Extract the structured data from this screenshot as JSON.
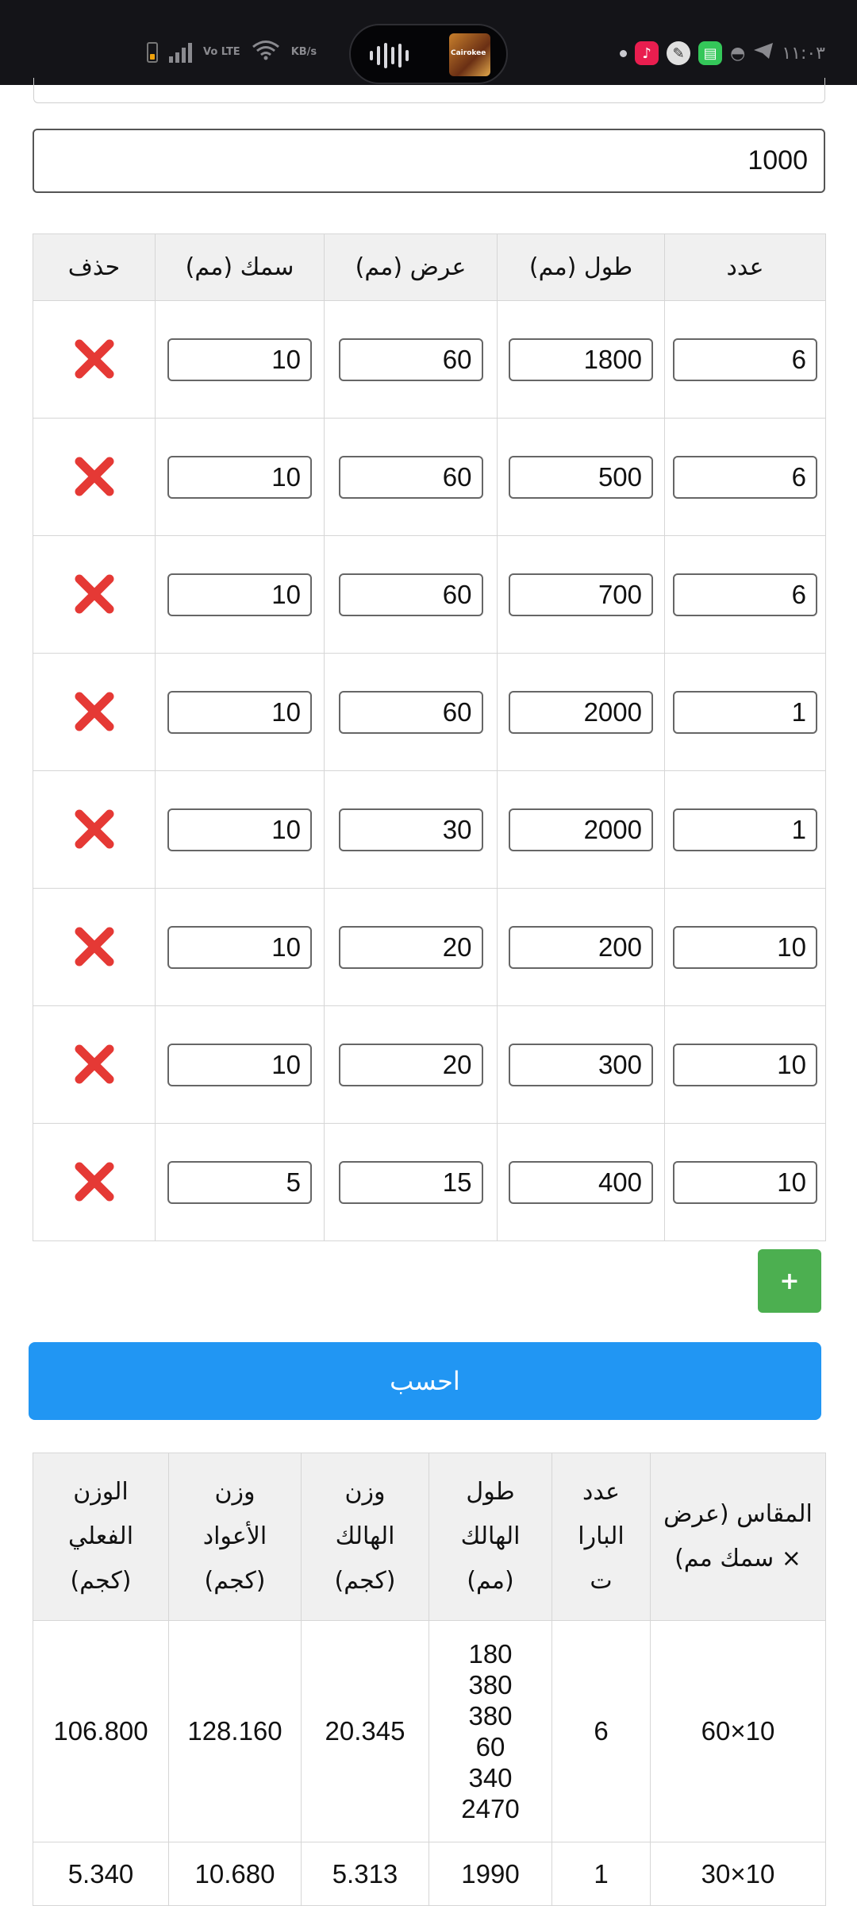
{
  "status_bar": {
    "time": "١١:٠٣",
    "network_small": "Vo LTE",
    "speed_unit": "KB/s",
    "album_label": "Cairokee",
    "icons": [
      "battery-icon",
      "signal-icon",
      "volte-icon",
      "wifi-icon",
      "audio-wave-icon",
      "music-app-icon",
      "calligraphy-app-icon",
      "messages-app-icon",
      "gamepad-icon",
      "telegram-icon"
    ]
  },
  "top_field": {
    "value": "1000"
  },
  "pieces_table": {
    "headers": {
      "count": "عدد",
      "length": "طول (مم)",
      "width": "عرض (مم)",
      "thickness": "سمك (مم)",
      "delete": "حذف"
    },
    "rows": [
      {
        "count": "6",
        "length": "1800",
        "width": "60",
        "thickness": "10"
      },
      {
        "count": "6",
        "length": "500",
        "width": "60",
        "thickness": "10"
      },
      {
        "count": "6",
        "length": "700",
        "width": "60",
        "thickness": "10"
      },
      {
        "count": "1",
        "length": "2000",
        "width": "60",
        "thickness": "10"
      },
      {
        "count": "1",
        "length": "2000",
        "width": "30",
        "thickness": "10"
      },
      {
        "count": "10",
        "length": "200",
        "width": "20",
        "thickness": "10"
      },
      {
        "count": "10",
        "length": "300",
        "width": "20",
        "thickness": "10"
      },
      {
        "count": "10",
        "length": "400",
        "width": "15",
        "thickness": "5"
      }
    ],
    "delete_icon": "red-x-icon",
    "delete_color": "#e53935"
  },
  "buttons": {
    "add_label": "+",
    "calculate_label": "احسب",
    "add_color": "#4caf50",
    "calculate_color": "#2196f3"
  },
  "results_table": {
    "headers": {
      "size": [
        "المقاس (عرض",
        "× سمك مم)"
      ],
      "bars": [
        "عدد",
        "البارا",
        "ت"
      ],
      "waste_length": [
        "طول",
        "الهالك",
        "(مم)"
      ],
      "waste_weight": [
        "وزن",
        "الهالك",
        "(كجم)"
      ],
      "bars_weight": [
        "وزن",
        "الأعواد",
        "(كجم)"
      ],
      "actual_weight": [
        "الوزن",
        "الفعلي",
        "(كجم)"
      ]
    },
    "rows": [
      {
        "size": "10×60",
        "bars": "6",
        "waste_length": [
          "180",
          "380",
          "380",
          "60",
          "340",
          "2470"
        ],
        "waste_weight": "20.345",
        "bars_weight": "128.160",
        "actual_weight": "106.800"
      },
      {
        "size": "10×30",
        "bars": "1",
        "waste_length": [
          "1990"
        ],
        "waste_weight": "5.313",
        "bars_weight": "10.680",
        "actual_weight": "5.340"
      }
    ]
  }
}
